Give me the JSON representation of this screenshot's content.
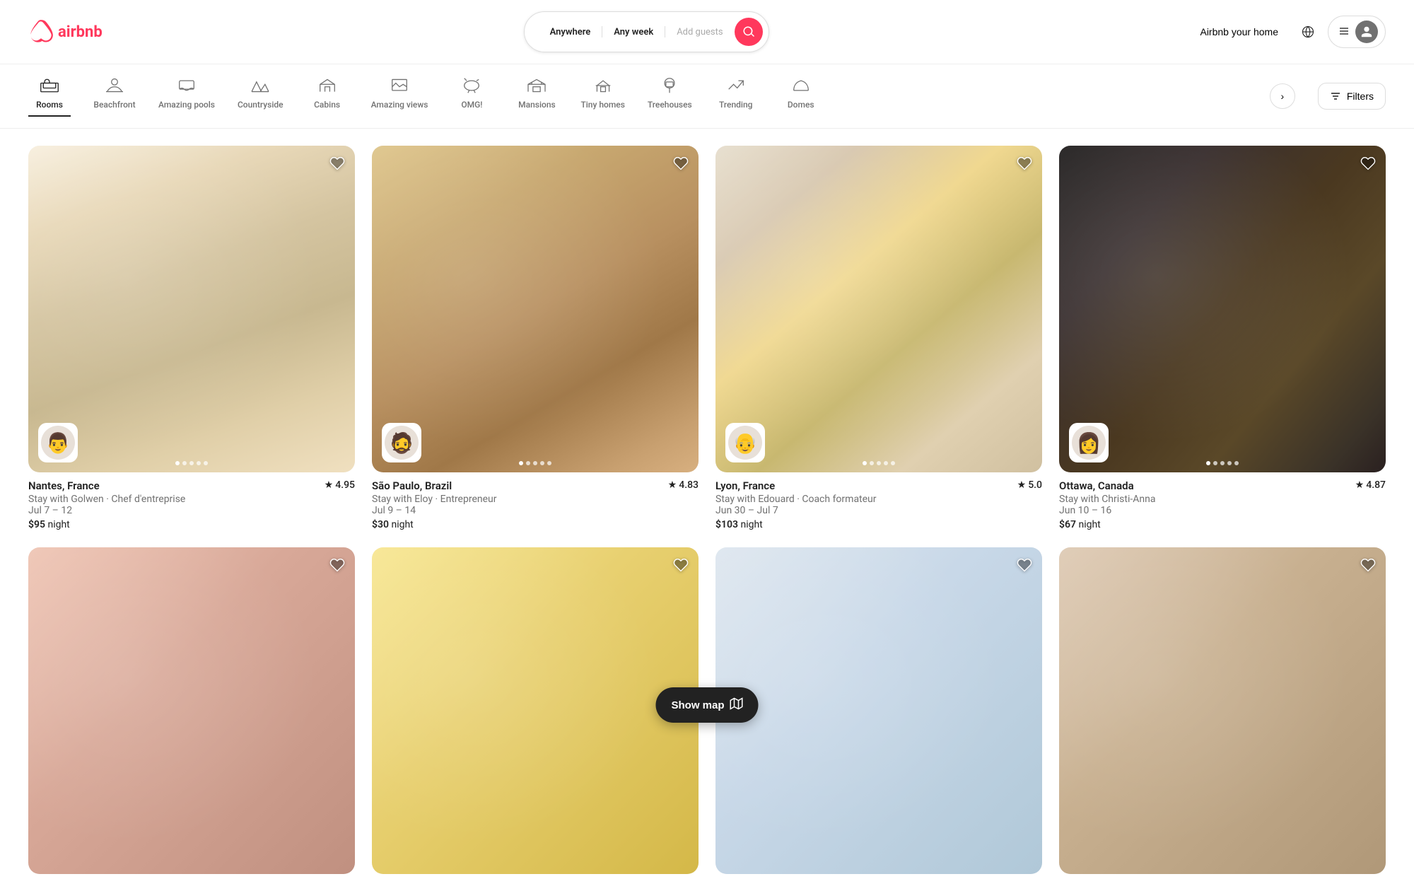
{
  "header": {
    "logo_text": "airbnb",
    "search": {
      "location_label": "Anywhere",
      "week_label": "Any week",
      "guests_placeholder": "Add guests"
    },
    "nav": {
      "host_label": "Airbnb your home",
      "globe_label": "Language and currency",
      "menu_label": "Menu",
      "profile_label": "Profile"
    }
  },
  "categories": [
    {
      "id": "rooms",
      "label": "Rooms",
      "icon": "🛏️",
      "active": true
    },
    {
      "id": "beachfront",
      "label": "Beachfront",
      "icon": "🏖️",
      "active": false
    },
    {
      "id": "amazing-pools",
      "label": "Amazing pools",
      "icon": "🏊",
      "active": false
    },
    {
      "id": "countryside",
      "label": "Countryside",
      "icon": "🌲",
      "active": false
    },
    {
      "id": "cabins",
      "label": "Cabins",
      "icon": "🏠",
      "active": false
    },
    {
      "id": "amazing-views",
      "label": "Amazing views",
      "icon": "🖼️",
      "active": false
    },
    {
      "id": "omg",
      "label": "OMG!",
      "icon": "🎪",
      "active": false
    },
    {
      "id": "mansions",
      "label": "Mansions",
      "icon": "🏰",
      "active": false
    },
    {
      "id": "tiny-homes",
      "label": "Tiny homes",
      "icon": "🏡",
      "active": false
    },
    {
      "id": "treehouses",
      "label": "Treehouses",
      "icon": "🌳",
      "active": false
    },
    {
      "id": "trending",
      "label": "Trending",
      "icon": "🔥",
      "active": false
    },
    {
      "id": "domes",
      "label": "Domes",
      "icon": "⛺",
      "active": false
    }
  ],
  "filters_label": "Filters",
  "listings": [
    {
      "id": "nantes",
      "location": "Nantes, France",
      "rating": "4.95",
      "subtitle": "Stay with Golwen · Chef d'entreprise",
      "dates": "Jul 7 – 12",
      "price": "$95",
      "price_unit": "night",
      "host_emoji": "👨",
      "img_class": "img-nantes",
      "dots": 5,
      "active_dot": 0
    },
    {
      "id": "saopaulo",
      "location": "São Paulo, Brazil",
      "rating": "4.83",
      "subtitle": "Stay with Eloy · Entrepreneur",
      "dates": "Jul 9 – 14",
      "price": "$30",
      "price_unit": "night",
      "host_emoji": "🧔",
      "img_class": "img-saopaulo",
      "dots": 5,
      "active_dot": 0
    },
    {
      "id": "lyon",
      "location": "Lyon, France",
      "rating": "5.0",
      "subtitle": "Stay with Edouard · Coach formateur",
      "dates": "Jun 30 – Jul 7",
      "price": "$103",
      "price_unit": "night",
      "host_emoji": "👴",
      "img_class": "img-lyon",
      "dots": 5,
      "active_dot": 0
    },
    {
      "id": "ottawa",
      "location": "Ottawa, Canada",
      "rating": "4.87",
      "subtitle": "Stay with Christi-Anna",
      "dates": "Jun 10 – 16",
      "price": "$67",
      "price_unit": "night",
      "host_emoji": "👩",
      "img_class": "img-ottawa",
      "dots": 5,
      "active_dot": 0
    },
    {
      "id": "partial1",
      "location": "",
      "rating": "",
      "subtitle": "",
      "dates": "",
      "price": "",
      "price_unit": "",
      "host_emoji": "",
      "img_class": "img-partial1",
      "dots": 0,
      "active_dot": 0
    },
    {
      "id": "partial2",
      "location": "",
      "rating": "",
      "subtitle": "",
      "dates": "",
      "price": "",
      "price_unit": "",
      "host_emoji": "",
      "img_class": "img-partial2",
      "dots": 0,
      "active_dot": 0
    },
    {
      "id": "partial3",
      "location": "",
      "rating": "",
      "subtitle": "",
      "dates": "",
      "price": "",
      "price_unit": "",
      "host_emoji": "",
      "img_class": "img-partial3",
      "dots": 0,
      "active_dot": 0
    },
    {
      "id": "partial4",
      "location": "",
      "rating": "",
      "subtitle": "",
      "dates": "",
      "price": "",
      "price_unit": "",
      "host_emoji": "",
      "img_class": "img-partial4",
      "dots": 0,
      "active_dot": 0
    }
  ],
  "show_map": {
    "label": "Show map",
    "icon": "map"
  }
}
